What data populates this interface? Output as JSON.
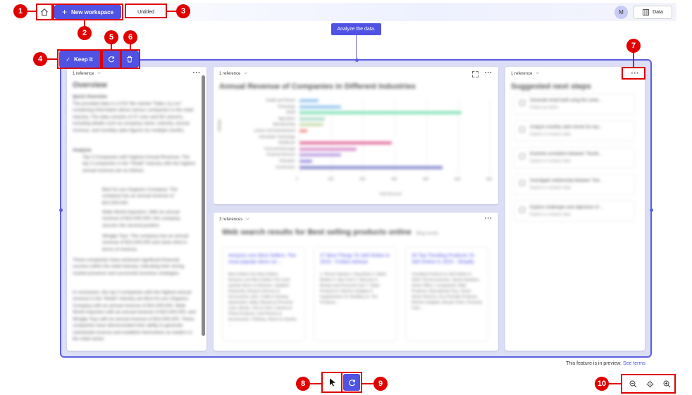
{
  "header": {
    "new_workspace_label": "New workspace",
    "tab_title": "Untitled",
    "avatar_initial": "M",
    "data_button_label": "Data"
  },
  "prompt": {
    "text": "Analyze the data."
  },
  "selection_toolbar": {
    "keep_label": "Keep it"
  },
  "overview_card": {
    "reference_label": "1 reference",
    "title": "Overview",
    "subtitle": "Quick Overview",
    "p1": "The provided data is a CSV file named \"Sales (1).csv\" containing information about various companies in the retail industry. The data consists of 37 rows and 65 columns, including details such as company name, industry, annual revenue, and monthly sales figures for multiple months.",
    "analysis_heading": "Analysis",
    "item1": "Top 3 Companies with Highest Annual Revenue: The top 3 companies in the \"Retail\" industry with the highest annual revenue are as follows:",
    "sub1": "Best for you Organics Company: The company has an annual revenue of $10,000,000.",
    "sub2": "Wide World Importers: With an annual revenue of $10,000,000, this company secures the second position.",
    "sub3": "Wingtip Toys: The company has an annual revenue of $10,000,000 and ranks third in terms of revenue.",
    "p2": "These companies have achieved significant financial success within the retail industry, indicating their strong market presence and successful business strategies.",
    "p3": "In conclusion, the top 3 companies with the highest annual revenue in the \"Retail\" industry are Best for you Organics Company with an annual revenue of $10,000,000, Wide World Importers with an annual revenue of $10,000,000, and Wingtip Toys with an annual revenue of $10,000,000. These companies have demonstrated their ability to generate substantial revenue and establish themselves as leaders in the retail sector."
  },
  "chart_card": {
    "reference_label": "1 reference"
  },
  "chart_data": {
    "type": "bar",
    "orientation": "horizontal",
    "title": "Annual Revenue of Companies in Different Industries",
    "xlabel": "Total Revenue",
    "ylabel": "Industry",
    "categories": [
      "Health and Fitness",
      "Technology",
      "Retail",
      "Agriculture",
      "Manufacturing",
      "Leisure and Entertainment",
      "Information Technology",
      "Healthcare",
      "Food and Beverage",
      "Financial Services",
      "Education",
      "Construction"
    ],
    "values": [
      60,
      130,
      510,
      80,
      75,
      25,
      0,
      290,
      180,
      130,
      40,
      450
    ],
    "colors": [
      "#8fc3ef",
      "#8fc3ef",
      "#7fe0b4",
      "#a9d9c4",
      "#c8dca9",
      "#f28b8b",
      "#e08cc0",
      "#e06a9a",
      "#d889c8",
      "#b89ae0",
      "#9a8ee0",
      "#7f82c9"
    ],
    "xticks": [
      "0",
      "100",
      "200",
      "300",
      "400",
      "500",
      "600"
    ],
    "xlim": [
      0,
      600
    ]
  },
  "web_card": {
    "reference_label": "3 references",
    "title": "Web search results for Best selling products online",
    "title_suffix": "Bing results",
    "results": [
      {
        "title": "Amazon.com Best Sellers: The most popular items on ...",
        "snippet": "Best Sellers Our Best Sellers Amazon.com Best Sellers The most popular items on Amazon. Updated frequently. Amazon Devices & Accessories, Arts, Crafts & Sewing, Automotive, Baby, Beauty & Personal Care, Books, CDs & Vinyl, Camera & Photo Products, Cell Phones & Accessories, Clothing, Shoes & Jewelry ..."
      },
      {
        "title": "27 Best Things To Sell Online in 2023 - Forbes Advisor",
        "snippet": "1. Phone Stands 2. Dog Beds 3. Water Bottles 4. Hair Care 5. Skincare 6. Beauty and Personal Care 7. Baby Products 8. Kitchen Gadgets 9. Supplements 10. Bedding 11. Pet Products ..."
      },
      {
        "title": "30 Top Trending Products To Sell Online In 2023 - Shopify",
        "snippet": "Trending Products to Sell Online in 2023: Pet Accessories, Sports Nutrition, Home Office, Loungewear, Bath Products, Educational Toys, Smart Home Devices, Eco-Friendly Products, Kitchen Gadgets, Beauty Tools, Personal Care ..."
      }
    ]
  },
  "steps_card": {
    "reference_label": "1 reference",
    "title": "Suggested next steps",
    "steps": [
      {
        "title": "Generate email draft using the conte...",
        "subtitle": "Follow-up action"
      },
      {
        "title": "Analyze monthly sales trends for eac...",
        "subtitle": "Explore or analyze data"
      },
      {
        "title": "Examine correlation between \"Numb...",
        "subtitle": "Explore or analyze data"
      },
      {
        "title": "Investigate relationship between \"Ind...",
        "subtitle": "Explore or analyze data"
      },
      {
        "title": "Explore challenges and objectives of ...",
        "subtitle": "Explore or analyze data"
      }
    ]
  },
  "footer": {
    "preview_text": "This feature is in preview.",
    "terms_link": "See terms"
  },
  "annotations": [
    "1",
    "2",
    "3",
    "4",
    "5",
    "6",
    "7",
    "8",
    "9",
    "10"
  ],
  "colors": {
    "accent": "#4f52e3",
    "annotation": "#e00000",
    "frame_bg": "#dcdef6"
  }
}
